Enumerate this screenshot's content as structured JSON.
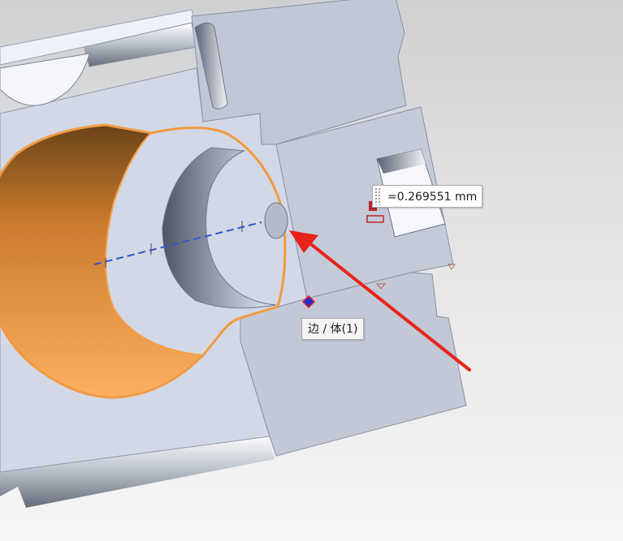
{
  "app": {
    "viewport": "cad-3d-view"
  },
  "measurement": {
    "value_text": "=0.269551 mm"
  },
  "selection": {
    "label": "边 / 体(1)"
  },
  "colors": {
    "part_face": "#d4d9e6",
    "part_side": "#bcc3d2",
    "highlight": "#f5a04a",
    "highlight_edge": "#f09a42",
    "arrow": "#e8231a",
    "centerline": "#3556c9",
    "selection_dot": "#1c2fd8"
  },
  "icons": {
    "arrow": "measure-arrow-icon",
    "grip": "drag-grip-icon",
    "marker": "selection-point-icon"
  }
}
